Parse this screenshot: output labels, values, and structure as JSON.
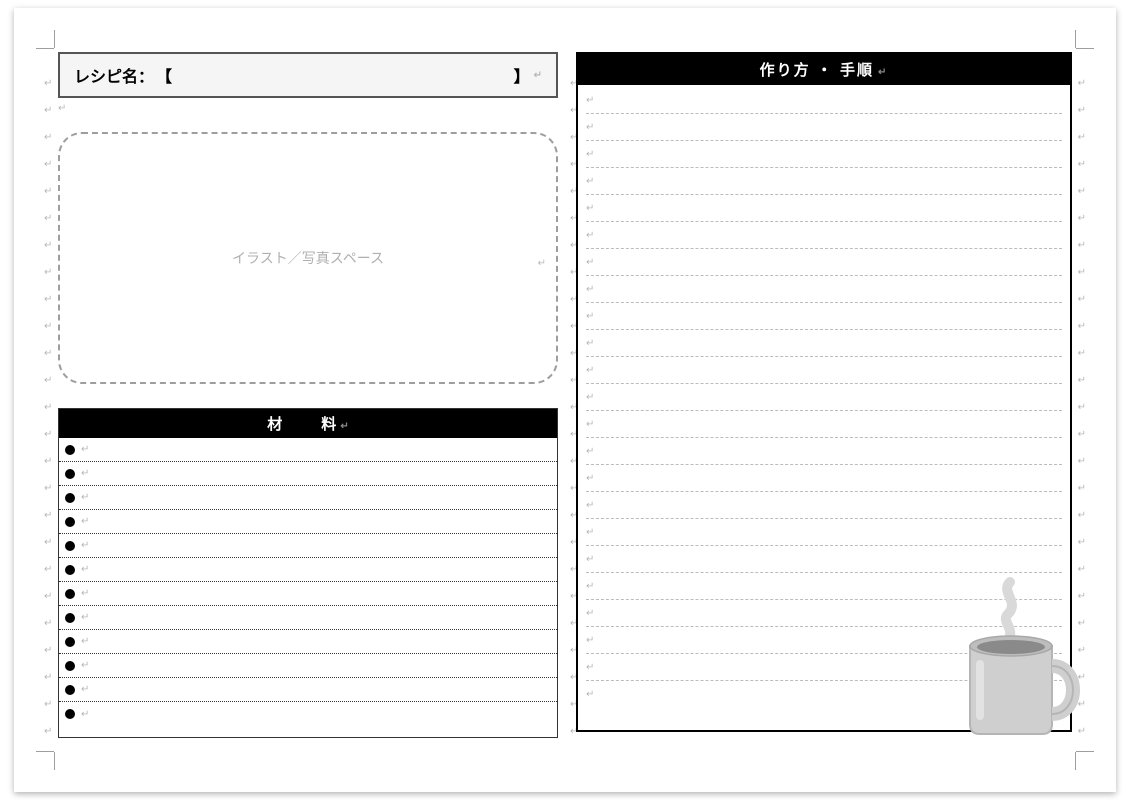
{
  "recipe": {
    "name_label": "レシピ名：",
    "bracket_open": "【",
    "bracket_close": "】",
    "name_value": ""
  },
  "photo": {
    "placeholder": "イラスト／写真スペース"
  },
  "ingredients": {
    "header": "材　料",
    "rows": [
      "",
      "",
      "",
      "",
      "",
      "",
      "",
      "",
      "",
      "",
      "",
      ""
    ]
  },
  "steps": {
    "header": "作り方 ・ 手順",
    "rows": [
      "",
      "",
      "",
      "",
      "",
      "",
      "",
      "",
      "",
      "",
      "",
      "",
      "",
      "",
      "",
      "",
      "",
      "",
      "",
      "",
      "",
      "",
      ""
    ]
  },
  "marks": {
    "return": "↵"
  },
  "decor": {
    "mug_icon": "coffee-mug-icon"
  }
}
